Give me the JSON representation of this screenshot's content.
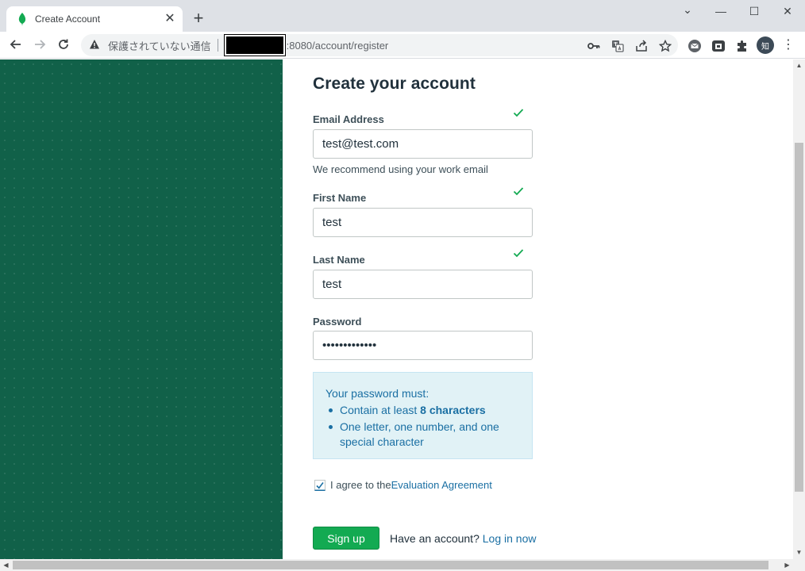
{
  "browser": {
    "tab_title": "Create Account",
    "tab_close": "✕",
    "new_tab": "+",
    "window_controls": {
      "minimize": "—",
      "maximize": "☐",
      "close": "✕",
      "tabs_menu": "⌄"
    },
    "security_label": "保護されていない通信",
    "url_suffix": ":8080/account/register",
    "profile_initial": "知",
    "menu_glyph": "⋮"
  },
  "page": {
    "heading": "Create your account",
    "email": {
      "label": "Email Address",
      "value": "test@test.com",
      "hint": "We recommend using your work email"
    },
    "first_name": {
      "label": "First Name",
      "value": "test"
    },
    "last_name": {
      "label": "Last Name",
      "value": "test"
    },
    "password": {
      "label": "Password",
      "value": "•••••••••••••"
    },
    "password_rules": {
      "title": "Your password must:",
      "rule1_prefix": "Contain at least ",
      "rule1_bold": "8 characters",
      "rule2": "One letter, one number, and one special character"
    },
    "agree": {
      "text": "I agree to the ",
      "link": "Evaluation Agreement",
      "checked": true
    },
    "signup_label": "Sign up",
    "have_account": "Have an account?",
    "login_link": "Log in now"
  },
  "colors": {
    "brand_green": "#116149",
    "button_green": "#13aa52",
    "link_blue": "#1a6fa3",
    "check_green": "#13aa52",
    "info_bg": "#e1f2f6"
  }
}
